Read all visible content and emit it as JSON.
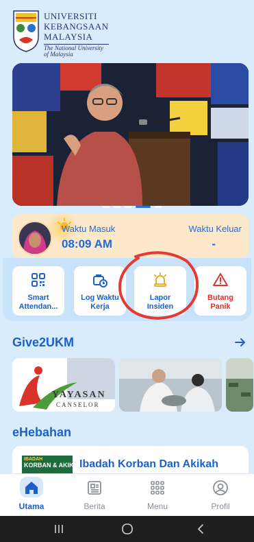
{
  "header": {
    "university_lines": [
      "UNIVERSITI",
      "KEBANGSAAN",
      "MALAYSIA"
    ],
    "university_english": [
      "The National University",
      "of Malaysia"
    ]
  },
  "banner": {
    "slides": 5,
    "active_slide": 4
  },
  "attendance": {
    "in_label": "Waktu Masuk",
    "in_time": "08:09 AM",
    "out_label": "Waktu Keluar",
    "out_time": "-"
  },
  "quick_actions": [
    {
      "label_1": "Smart",
      "label_2": "Attendan...",
      "icon": "qr-scan-icon"
    },
    {
      "label_1": "Log Waktu",
      "label_2": "Kerja",
      "icon": "work-log-icon"
    },
    {
      "label_1": "Lapor",
      "label_2": "Insiden",
      "icon": "siren-icon"
    },
    {
      "label_1": "Butang",
      "label_2": "Panik",
      "icon": "warning-icon"
    }
  ],
  "give2ukm": {
    "title": "Give2UKM",
    "cards": [
      {
        "caption_top": "YAYASAN",
        "caption_bottom": "CANSELOR"
      },
      {},
      {}
    ]
  },
  "ehebahan": {
    "title": "eHebahan",
    "items": [
      {
        "thumb_line_1": "IBADAH",
        "thumb_line_2": "KORBAN & AKIKA",
        "title": "Ibadah Korban Dan Akikah"
      }
    ]
  },
  "bottom_nav": [
    {
      "label": "Utama",
      "icon": "home-icon",
      "active": true
    },
    {
      "label": "Berita",
      "icon": "news-icon",
      "active": false
    },
    {
      "label": "Menu",
      "icon": "menu-grid-icon",
      "active": false
    },
    {
      "label": "Profil",
      "icon": "profile-icon",
      "active": false
    }
  ],
  "colors": {
    "background": "#d9ecfb",
    "accent": "#1b61c9",
    "attendance_card": "#fde8cc",
    "danger": "#d9342b",
    "annotation_circle": "#e53935"
  }
}
